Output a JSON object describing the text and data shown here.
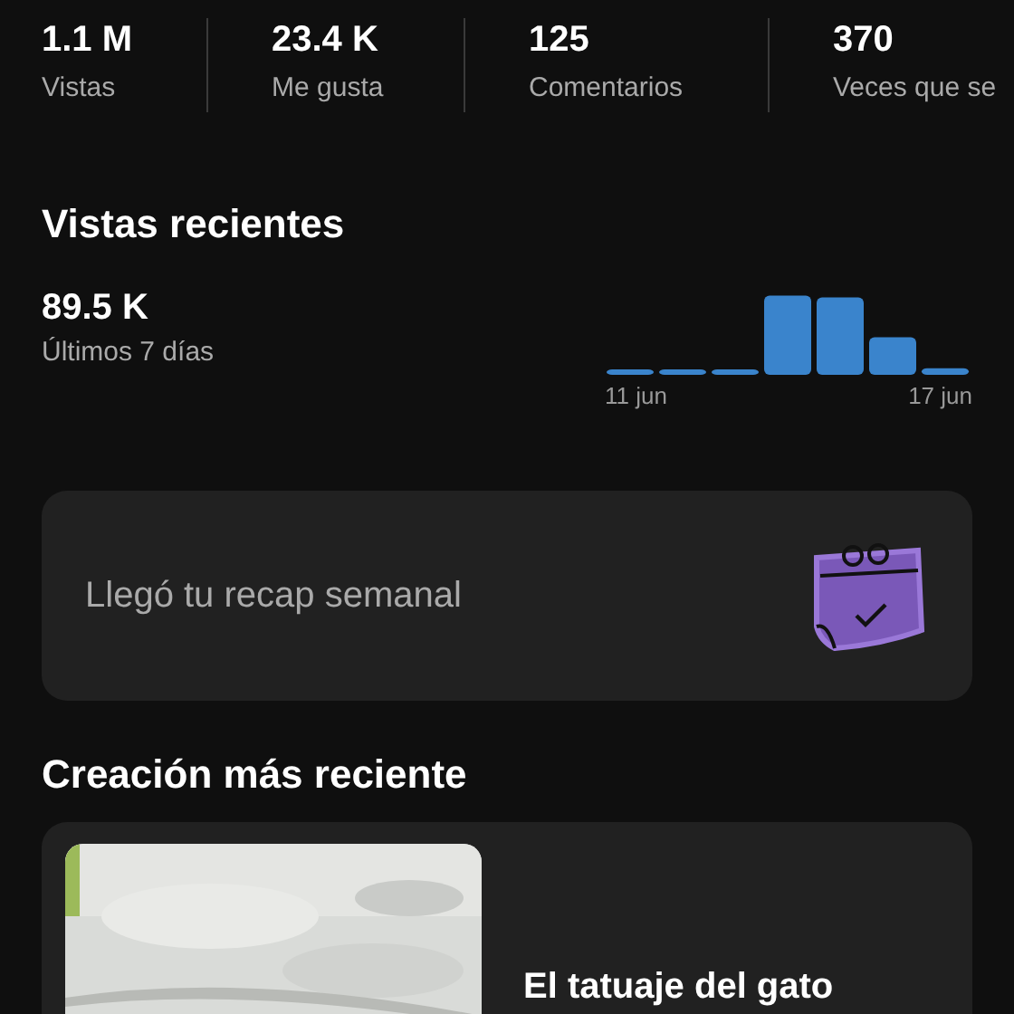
{
  "stats": [
    {
      "value": "1.1 M",
      "label": "Vistas"
    },
    {
      "value": "23.4 K",
      "label": "Me gusta"
    },
    {
      "value": "125",
      "label": "Comentarios"
    },
    {
      "value": "370",
      "label": "Veces que se"
    }
  ],
  "recent_views": {
    "title": "Vistas recientes",
    "value": "89.5 K",
    "period": "Últimos 7 días",
    "axis_start": "11 jun",
    "axis_end": "17 jun"
  },
  "recap_card": {
    "text": "Llegó tu recap semanal"
  },
  "latest": {
    "title": "Creación más reciente",
    "video": {
      "title": "El tatuaje del gato"
    }
  }
}
